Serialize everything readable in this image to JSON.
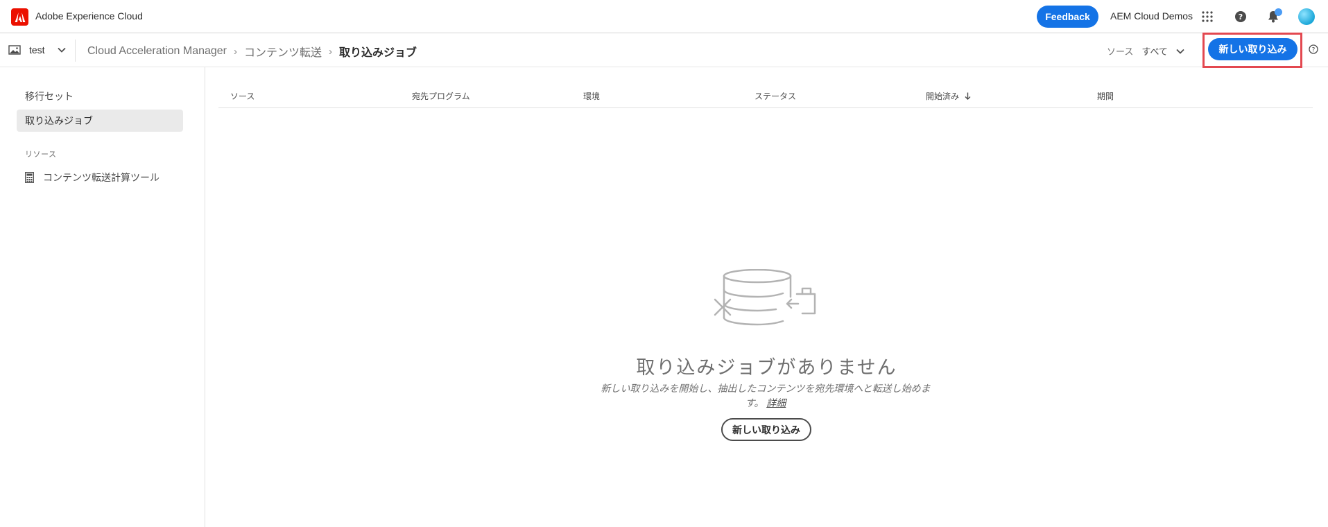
{
  "global_header": {
    "product_name": "Adobe Experience Cloud",
    "feedback_label": "Feedback",
    "org_name": "AEM Cloud Demos",
    "icons": [
      "adobe-logo-icon",
      "apps-grid-icon",
      "help-icon",
      "bell-icon",
      "avatar"
    ],
    "accent_color": "#1473e6",
    "logo_color": "#eb1000"
  },
  "sub_header": {
    "program_name": "test",
    "breadcrumb": [
      "Cloud Acceleration Manager",
      "コンテンツ転送"
    ],
    "breadcrumb_current": "取り込みジョブ",
    "source_filter_label": "ソース",
    "source_filter_value": "すべて",
    "new_ingest_label": "新しい取り込み",
    "highlight_color": "#e34850"
  },
  "left_nav": {
    "items": [
      {
        "label": "移行セット"
      },
      {
        "label": "取り込みジョブ",
        "active": true
      }
    ],
    "section_label": "リソース",
    "tool_label": "コンテンツ転送計算ツール",
    "tool_icon": "calculator-icon"
  },
  "table": {
    "columns": [
      "ソース",
      "宛先プログラム",
      "環境",
      "ステータス",
      "開始済み",
      "期間"
    ],
    "sort_column": "開始済み",
    "sort_direction": "descending"
  },
  "empty_state": {
    "illustration": "database-transfer-icon",
    "title": "取り込みジョブがありません",
    "description": "新しい取り込みを開始し、抽出したコンテンツを宛先環境へと転送し始めます。",
    "link_label": "詳細",
    "button_label": "新しい取り込み"
  }
}
